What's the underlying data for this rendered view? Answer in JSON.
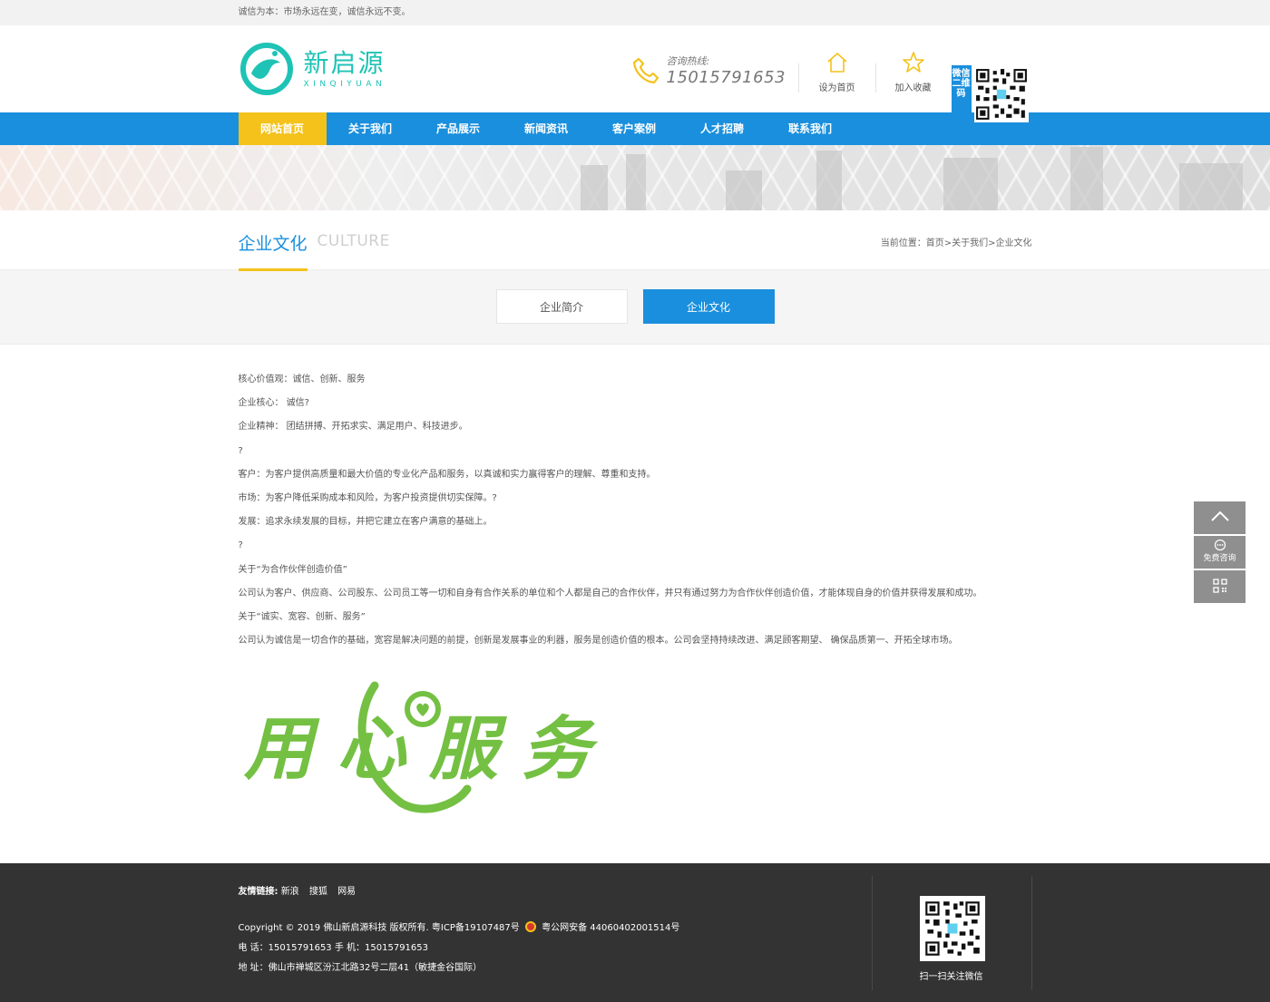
{
  "topbar": {
    "slogan": "诚信为本：市场永远在变，诚信永远不变。"
  },
  "header": {
    "logo_cn": "新启源",
    "logo_en": "XINQIYUAN",
    "hotline_label": "咨询热线:",
    "hotline_number": "15015791653",
    "set_home": "设为首页",
    "add_fav": "加入收藏",
    "wechat_tag": "微信二维码"
  },
  "nav": {
    "items": [
      {
        "label": "网站首页"
      },
      {
        "label": "关于我们"
      },
      {
        "label": "产品展示"
      },
      {
        "label": "新闻资讯"
      },
      {
        "label": "客户案例"
      },
      {
        "label": "人才招聘"
      },
      {
        "label": "联系我们"
      }
    ],
    "active_index": 0
  },
  "page": {
    "title": "企业文化",
    "title_en": "CULTURE",
    "breadcrumb": "当前位置：首页>关于我们>企业文化"
  },
  "tabs": [
    {
      "label": "企业简介"
    },
    {
      "label": "企业文化"
    }
  ],
  "content": {
    "paragraphs": [
      "核心价值观：诚信、创新、服务",
      "企业核心： 诚信?",
      "企业精神： 团结拼搏、开拓求实、满足用户、科技进步。",
      "?",
      "客户：为客户提供高质量和最大价值的专业化产品和服务，以真诚和实力赢得客户的理解、尊重和支持。",
      "市场：为客户降低采购成本和风险，为客户投资提供切实保障。?",
      "发展：追求永续发展的目标，并把它建立在客户满意的基础上。",
      "?",
      "关于“为合作伙伴创造价值”",
      "公司认为客户、供应商、公司股东、公司员工等一切和自身有合作关系的单位和个人都是自己的合作伙伴，并只有通过努力为合作伙伴创造价值，才能体现自身的价值并获得发展和成功。",
      "关于“诚实、宽容、创新、服务”",
      "公司认为诚信是一切合作的基础，宽容是解决问题的前提，创新是发展事业的利器，服务是创造价值的根本。公司会坚持持续改进、满足顾客期望、 确保品质第一、开拓全球市场。"
    ],
    "art_text": "用心服务",
    "art_color": "#74c043"
  },
  "footer": {
    "links_label": "友情链接:",
    "links": [
      "新浪",
      "搜狐",
      "网易"
    ],
    "copyright": "Copyright © 2019 佛山新启源科技 版权所有. 粤ICP备19107487号",
    "police": "粤公网安备 44060402001514号",
    "phone": "电 话：15015791653   手 机：15015791653",
    "address": "地 址：佛山市禅城区汾江北路32号二层41（敏捷金谷国际）",
    "qr_caption": "扫一扫关注微信"
  },
  "float": {
    "consult": "免费咨询"
  },
  "colors": {
    "primary": "#1a8fdd",
    "accent": "#f4c21b",
    "brand": "#1fc3b5",
    "footer_bg": "#333333"
  }
}
